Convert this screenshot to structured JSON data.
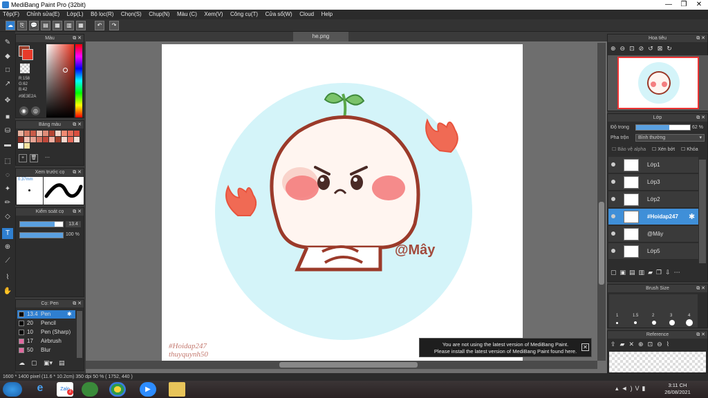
{
  "window": {
    "title": "MediBang Paint Pro (32bit)"
  },
  "menu": [
    "Tệp(F)",
    "Chỉnh sửa(E)",
    "Lớp(L)",
    "Bộ lọc(R)",
    "Chọn(S)",
    "Chụp(N)",
    "Màu (C)",
    "Xem(V)",
    "Công cụ(T)",
    "Cửa sổ(W)",
    "Cloud",
    "Help"
  ],
  "color_panel": {
    "title": "Màu",
    "r": "R:158",
    "g": "G:62",
    "b": "B:42",
    "hex": "#9E3E2A",
    "main_color": "#9e3e2a"
  },
  "palette_panel": {
    "title": "Bảng màu",
    "dash": "---"
  },
  "brush_preview_panel": {
    "title": "Xem trước cọ",
    "size": "0.37mm"
  },
  "control_panel": {
    "title": "Kiểm soát cọ",
    "size_value": "13.4",
    "opacity_value": "100 %",
    "size_fraction": 0.8,
    "opacity_fraction": 1.0
  },
  "brush_panel": {
    "title": "Cọ: Pen",
    "items": [
      {
        "size": "13.4",
        "name": "Pen",
        "selected": true
      },
      {
        "size": "20",
        "name": "Pencil",
        "selected": false
      },
      {
        "size": "10",
        "name": "Pen (Sharp)",
        "selected": false
      },
      {
        "size": "17",
        "name": "Airbrush",
        "selected": false
      },
      {
        "size": "50",
        "name": "Blur",
        "selected": false
      }
    ]
  },
  "document": {
    "tab_name": "he.png"
  },
  "artwork": {
    "signature_text": "@Mây",
    "watermark_line1": "#Hoidap247",
    "watermark_line2": "thuyquynh50"
  },
  "navigator_panel": {
    "title": "Hoa tiêu"
  },
  "layer_panel": {
    "title": "Lớp",
    "opacity_label": "Độ trong",
    "opacity_value": "62 %",
    "opacity_fraction": 0.62,
    "blend_label": "Pha trộn",
    "blend_value": "Bình thường",
    "protect_alpha": "Bảo vệ alpha",
    "clipping": "Xén bớt",
    "lock": "Khóa",
    "layers": [
      {
        "name": "Lớp1",
        "selected": false
      },
      {
        "name": "Lớp3",
        "selected": false
      },
      {
        "name": "Lớp2",
        "selected": false
      },
      {
        "name": "#Hoidap247",
        "selected": true
      },
      {
        "name": "@Mây",
        "selected": false
      },
      {
        "name": "Lớp5",
        "selected": false
      }
    ]
  },
  "brush_size_panel": {
    "title": "Brush Size",
    "labels": [
      "1",
      "1.5",
      "2",
      "3",
      "4"
    ]
  },
  "reference_panel": {
    "title": "Reference"
  },
  "notice": {
    "line1": "You are not using the latest version of MediBang Paint.",
    "line2": "Please install the latest version of MediBang Paint found here."
  },
  "status": {
    "text": "1600 * 1400 pixel   (11.6 * 10.2cm)   350 dpi   50 %   ( 1752, 440 )"
  },
  "taskbar": {
    "time": "3:11 CH",
    "date": "26/08/2021",
    "badge": "2"
  }
}
